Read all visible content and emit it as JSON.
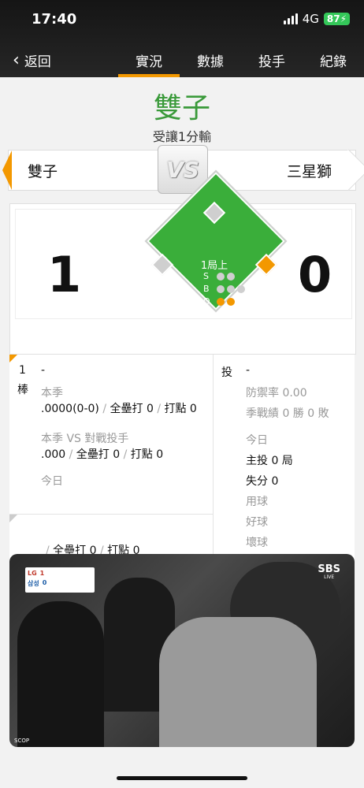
{
  "status": {
    "time": "17:40",
    "network": "4G",
    "battery": "87"
  },
  "nav": {
    "back_label": "返回",
    "tabs": [
      {
        "label": "實況",
        "active": true
      },
      {
        "label": "數據",
        "active": false
      },
      {
        "label": "投手",
        "active": false
      },
      {
        "label": "紀錄",
        "active": false
      }
    ]
  },
  "game": {
    "winner": "雙子",
    "result_text": "受讓1分輸",
    "vs_label": "VS",
    "home_team": "雙子",
    "away_team": "三星獅",
    "home_score": "1",
    "away_score": "0",
    "inning": "1局上",
    "count": {
      "s_label": "S",
      "b_label": "B",
      "o_label": "O",
      "strikes": 0,
      "balls": 0,
      "outs": 2
    },
    "bases": {
      "first": true,
      "second": false,
      "third": false
    }
  },
  "batter": {
    "order_num": "1",
    "order_label": "棒",
    "name": "-",
    "season_label": "本季",
    "season_avg": ".0000(0-0)",
    "season_hr": "全壘打 0",
    "season_rbi": "打點 0",
    "vs_label": "本季 VS 對戰投手",
    "vs_avg": ".000",
    "vs_hr": "全壘打 0",
    "vs_rbi": "打點 0",
    "today_label": "今日",
    "next_hr": "全壘打 0",
    "next_rbi": "打點 0"
  },
  "pitcher": {
    "role_label": "投",
    "name": "-",
    "era": "防禦率 0.00",
    "record": "季戰績 0 勝 0 敗",
    "today_label": "今日",
    "innings": "主投 0 局",
    "runs": "失分 0",
    "pitches": "用球",
    "strikes": "好球",
    "balls": "壞球"
  },
  "video": {
    "bug_team1": "LG",
    "bug_score1": "1",
    "bug_team2": "삼성",
    "bug_score2": "0",
    "broadcaster": "SBS",
    "broadcaster_sub": "LIVE",
    "watermark": "SCOP"
  }
}
